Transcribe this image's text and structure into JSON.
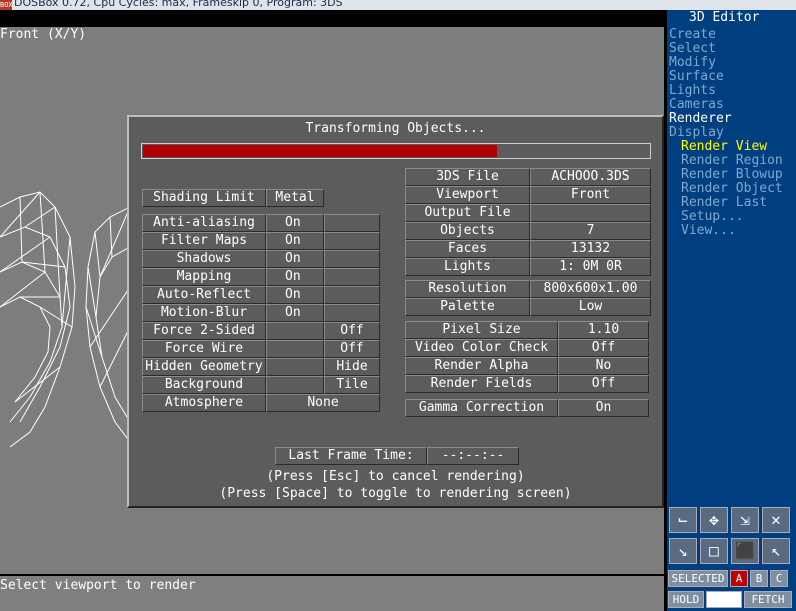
{
  "titlebar": {
    "text": "DOSBox 0.72, Cpu Cycles:      max, Frameskip  0, Program:      3DS"
  },
  "viewport": {
    "label": "Front (X/Y)"
  },
  "status": {
    "text": "Select viewport to render"
  },
  "panel": {
    "title": "3D Editor",
    "menu": [
      "Create",
      "Select",
      "Modify",
      "Surface",
      "Lights",
      "Cameras"
    ],
    "renderer": "Renderer",
    "display": "Display",
    "submenu": [
      "Render View",
      "Render Region",
      "Render Blowup",
      "Render Object",
      "Render Last",
      "Setup...",
      "View..."
    ],
    "selected_label": "SELECTED",
    "sel_a": "A",
    "sel_b": "B",
    "sel_c": "C",
    "hold": "HOLD",
    "fetch": "FETCH"
  },
  "dialog": {
    "title": "Transforming Objects...",
    "progress": 0.7,
    "shading_label": "Shading Limit",
    "shading_value": "Metal",
    "left_rows": [
      {
        "label": "Anti-aliasing",
        "on": "On",
        "off": ""
      },
      {
        "label": "Filter Maps",
        "on": "On",
        "off": ""
      },
      {
        "label": "Shadows",
        "on": "On",
        "off": ""
      },
      {
        "label": "Mapping",
        "on": "On",
        "off": ""
      },
      {
        "label": "Auto-Reflect",
        "on": "On",
        "off": ""
      },
      {
        "label": "Motion-Blur",
        "on": "On",
        "off": ""
      },
      {
        "label": "Force 2-Sided",
        "on": "",
        "off": "Off"
      },
      {
        "label": "Force Wire",
        "on": "",
        "off": "Off"
      },
      {
        "label": "Hidden Geometry",
        "on": "",
        "off": "Hide"
      },
      {
        "label": "Background",
        "on": "",
        "off": "Tile"
      }
    ],
    "atmosphere_label": "Atmosphere",
    "atmosphere_value": "None",
    "info_rows": [
      {
        "label": "3DS File",
        "value": "ACHOOO.3DS"
      },
      {
        "label": "Viewport",
        "value": "Front"
      },
      {
        "label": "Output File",
        "value": ""
      },
      {
        "label": "Objects",
        "value": "7"
      },
      {
        "label": "Faces",
        "value": "13132"
      },
      {
        "label": "Lights",
        "value": "1: 0M 0R"
      }
    ],
    "res_rows": [
      {
        "label": "Resolution",
        "value": "800x600x1.00"
      },
      {
        "label": "Palette",
        "value": "Low"
      }
    ],
    "opt_rows": [
      {
        "label": "Pixel Size",
        "value": "1.10"
      },
      {
        "label": "Video Color Check",
        "value": "Off"
      },
      {
        "label": "Render Alpha",
        "value": "No"
      },
      {
        "label": "Render Fields",
        "value": "Off"
      }
    ],
    "gamma_label": "Gamma Correction",
    "gamma_value": "On",
    "last_frame_label": "Last Frame Time:",
    "last_frame_value": "--:--:--",
    "note1": "(Press [Esc] to cancel rendering)",
    "note2": "(Press [Space] to toggle to rendering screen)"
  }
}
